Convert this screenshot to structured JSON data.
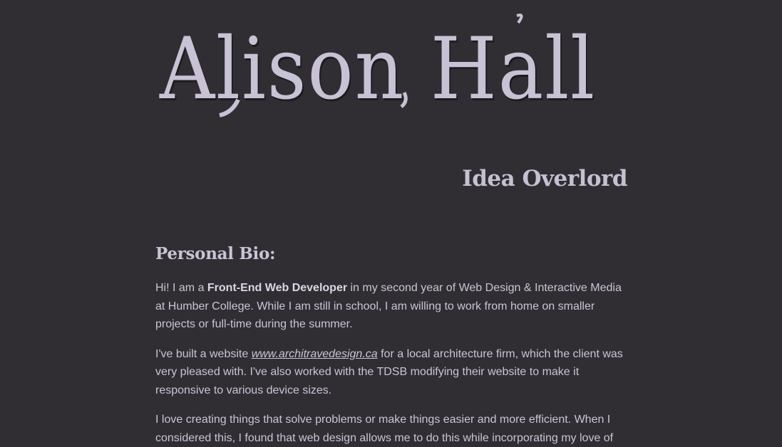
{
  "header": {
    "name": "Alison Hall",
    "tagline": "Idea Overlord"
  },
  "bio": {
    "heading": "Personal Bio:",
    "p1": {
      "before": "Hi! I am a ",
      "strong": "Front-End Web Developer",
      "after": " in my second year of Web Design & Interactive Media at Humber College. While I am still in school, I am willing to work from home on smaller projects or full-time during the summer."
    },
    "p2": {
      "before": "I've built a website ",
      "link": "www.architravedesign.ca",
      "after": " for a local architecture firm, which the client was very pleased with. I've also worked with the TDSB modifying their website to make it responsive to various device sizes."
    },
    "p3": "I love creating things that solve problems or make things easier and more efficient. When I considered this, I found that web design allows me to do this while incorporating my love of"
  },
  "colors": {
    "background": "#302e33",
    "text": "#cbc4d6"
  }
}
